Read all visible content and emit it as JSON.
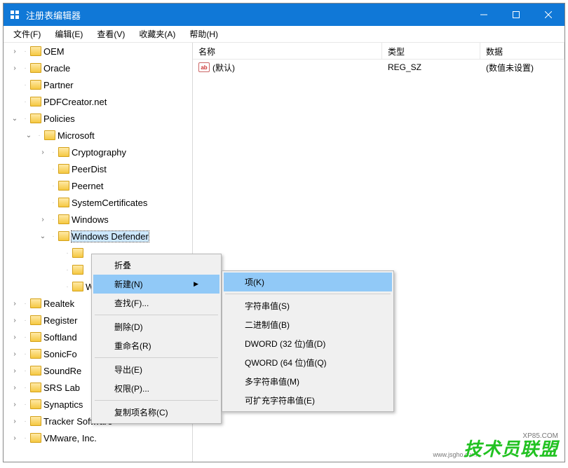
{
  "window": {
    "title": "注册表编辑器"
  },
  "menubar": [
    "文件(F)",
    "编辑(E)",
    "查看(V)",
    "收藏夹(A)",
    "帮助(H)"
  ],
  "tree": [
    {
      "indent": 0,
      "expand": ">",
      "label": "OEM"
    },
    {
      "indent": 0,
      "expand": ">",
      "label": "Oracle"
    },
    {
      "indent": 0,
      "expand": "",
      "label": "Partner"
    },
    {
      "indent": 0,
      "expand": "",
      "label": "PDFCreator.net"
    },
    {
      "indent": 0,
      "expand": "v",
      "label": "Policies"
    },
    {
      "indent": 1,
      "expand": "v",
      "label": "Microsoft"
    },
    {
      "indent": 2,
      "expand": ">",
      "label": "Cryptography"
    },
    {
      "indent": 2,
      "expand": "",
      "label": "PeerDist"
    },
    {
      "indent": 2,
      "expand": "",
      "label": "Peernet"
    },
    {
      "indent": 2,
      "expand": "",
      "label": "SystemCertificates"
    },
    {
      "indent": 2,
      "expand": ">",
      "label": "Windows"
    },
    {
      "indent": 2,
      "expand": "v",
      "label": "Windows Defender",
      "selected": true
    },
    {
      "indent": 3,
      "expand": "",
      "label": ""
    },
    {
      "indent": 3,
      "expand": "",
      "label": ""
    },
    {
      "indent": 3,
      "expand": "",
      "label": "W"
    },
    {
      "indent": 0,
      "expand": ">",
      "label": "Realtek"
    },
    {
      "indent": 0,
      "expand": ">",
      "label": "Register"
    },
    {
      "indent": 0,
      "expand": ">",
      "label": "Softland"
    },
    {
      "indent": 0,
      "expand": ">",
      "label": "SonicFo"
    },
    {
      "indent": 0,
      "expand": ">",
      "label": "SoundRe"
    },
    {
      "indent": 0,
      "expand": ">",
      "label": "SRS Lab"
    },
    {
      "indent": 0,
      "expand": ">",
      "label": "Synaptics"
    },
    {
      "indent": 0,
      "expand": ">",
      "label": "Tracker Software"
    },
    {
      "indent": 0,
      "expand": ">",
      "label": "VMware, Inc."
    }
  ],
  "columns": {
    "name": "名称",
    "type": "类型",
    "data": "数据"
  },
  "rows": [
    {
      "name": "(默认)",
      "type": "REG_SZ",
      "data": "(数值未设置)",
      "icon": "ab"
    }
  ],
  "contextMenu1": [
    {
      "label": "折叠"
    },
    {
      "label": "新建(N)",
      "arrow": true,
      "highlight": true
    },
    {
      "label": "查找(F)..."
    },
    {
      "sep": true
    },
    {
      "label": "删除(D)"
    },
    {
      "label": "重命名(R)"
    },
    {
      "sep": true
    },
    {
      "label": "导出(E)"
    },
    {
      "label": "权限(P)..."
    },
    {
      "sep": true
    },
    {
      "label": "复制项名称(C)"
    }
  ],
  "contextMenu2": [
    {
      "label": "项(K)",
      "highlight": true
    },
    {
      "sep": true
    },
    {
      "label": "字符串值(S)"
    },
    {
      "label": "二进制值(B)"
    },
    {
      "label": "DWORD (32 位)值(D)"
    },
    {
      "label": "QWORD (64 位)值(Q)"
    },
    {
      "label": "多字符串值(M)"
    },
    {
      "label": "可扩充字符串值(E)"
    }
  ],
  "watermarks": {
    "url1": "www.jsgho.com",
    "brand": "技术员联盟",
    "url2": "XP85.COM"
  }
}
